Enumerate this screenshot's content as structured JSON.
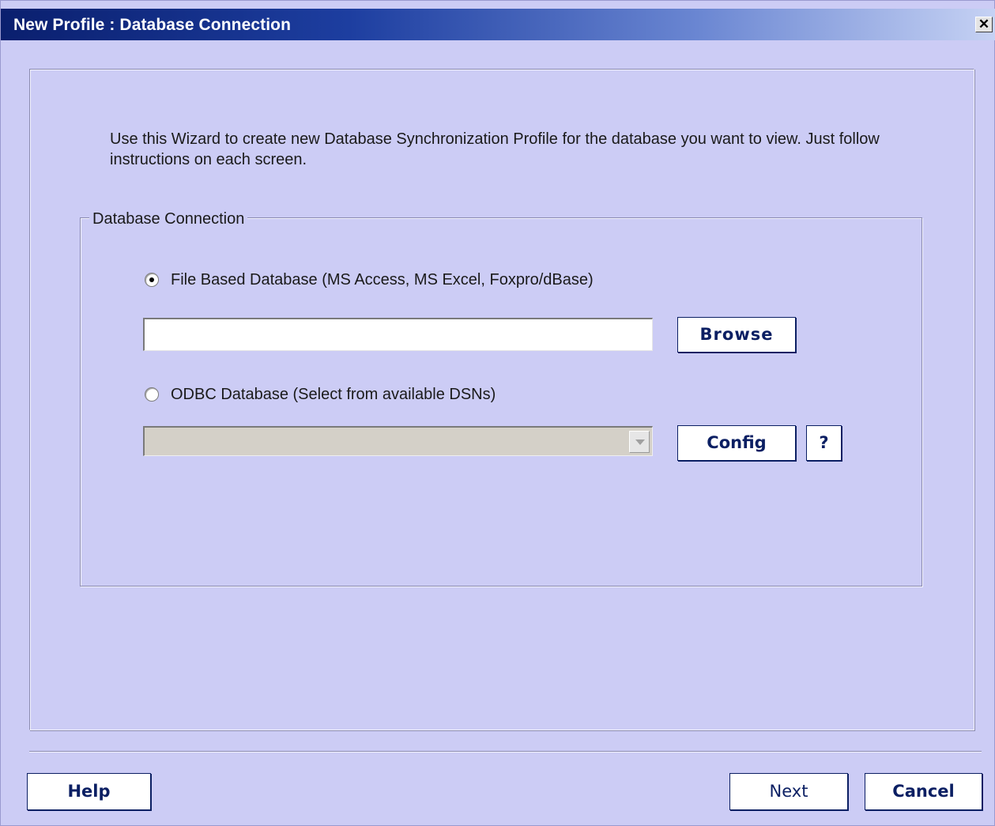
{
  "window": {
    "title": "New Profile : Database Connection",
    "close_glyph": "✕"
  },
  "intro": {
    "text": "Use this Wizard to create new Database Synchronization Profile for the database you want to view. Just follow instructions on each screen."
  },
  "group": {
    "legend": "Database Connection",
    "file_option": {
      "label": "File Based Database (MS Access, MS Excel, Foxpro/dBase)",
      "selected": true
    },
    "file_path": {
      "value": "",
      "placeholder": ""
    },
    "browse_label": "Browse",
    "odbc_option": {
      "label": "ODBC Database (Select from available DSNs)",
      "selected": false
    },
    "dsn_select": {
      "value": "",
      "enabled": false
    },
    "config_label": "Config",
    "help_glyph": "?"
  },
  "footer": {
    "help_label": "Help",
    "next_label": "Next",
    "cancel_label": "Cancel"
  },
  "icons": {
    "close": "close-icon",
    "dropdown": "chevron-down-icon"
  },
  "colors": {
    "window_bg": "#ccccf5",
    "title_start": "#0a1f6e",
    "title_end": "#c6d2f4",
    "button_text": "#0b1f63"
  }
}
